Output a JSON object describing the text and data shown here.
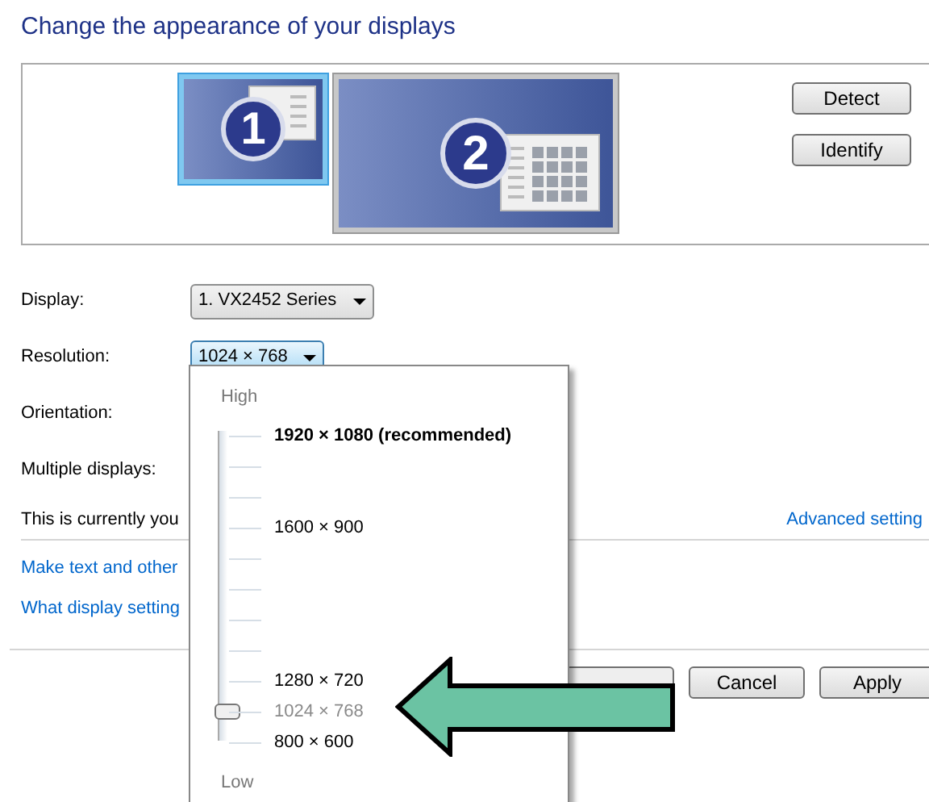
{
  "title": "Change the appearance of your displays",
  "monitors": [
    {
      "number": "1",
      "selected": true
    },
    {
      "number": "2",
      "selected": false
    }
  ],
  "preview_buttons": [
    "Detect",
    "Identify"
  ],
  "fields": [
    {
      "label": "Display:",
      "value": "1. VX2452 Series",
      "expanded": false
    },
    {
      "label": "Resolution:",
      "value": "1024 × 768",
      "expanded": true
    },
    {
      "label": "Orientation:"
    },
    {
      "label": "Multiple displays:"
    }
  ],
  "status_text": "This is currently you",
  "advanced_link": "Advanced setting",
  "links": [
    "Make text and other",
    "What display setting"
  ],
  "buttons": [
    "Cancel",
    "Apply"
  ],
  "resolution_menu": {
    "high_label": "High",
    "low_label": "Low",
    "level": 0.1,
    "stops": [
      {
        "label": "1920 × 1080 (recommended)",
        "kind": "recommended",
        "selected": false
      },
      {
        "kind": "tick"
      },
      {
        "kind": "tick"
      },
      {
        "label": "1600 × 900",
        "kind": "option",
        "selected": false
      },
      {
        "kind": "tick"
      },
      {
        "kind": "tick"
      },
      {
        "kind": "tick"
      },
      {
        "kind": "tick"
      },
      {
        "label": "1280 × 720",
        "kind": "option",
        "selected": false
      },
      {
        "label": "1024 × 768",
        "kind": "option",
        "selected": true
      },
      {
        "label": "800 × 600",
        "kind": "option",
        "selected": false
      }
    ]
  }
}
